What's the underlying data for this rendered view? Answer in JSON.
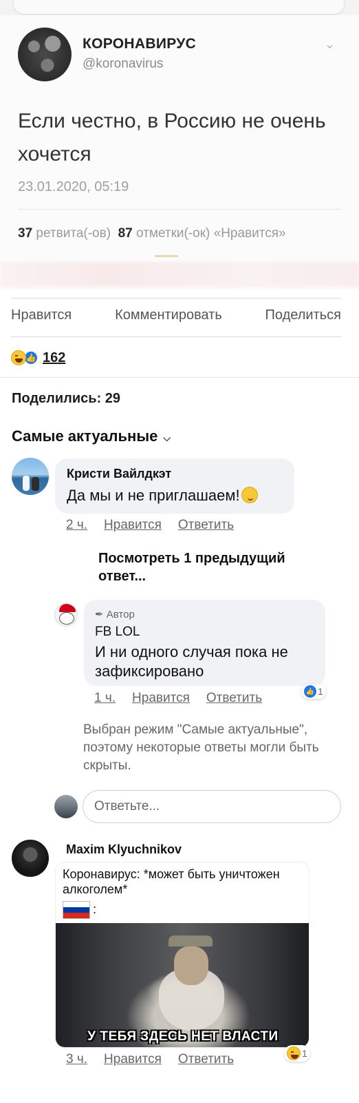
{
  "tweet": {
    "name": "КОРОНАВИРУС",
    "handle": "@koronavirus",
    "text": "Если честно, в Россию не очень хочется",
    "date": "23.01.2020, 05:19",
    "retweets_count": "37",
    "retweets_label": "ретвита(-ов)",
    "likes_count": "87",
    "likes_label": "отметки(-ок) «Нравится»"
  },
  "actions": {
    "like": "Нравится",
    "comment": "Комментировать",
    "share": "Поделиться"
  },
  "reactions": {
    "count": "162"
  },
  "shares_text": "Поделились: 29",
  "sort_label": "Самые актуальные",
  "comments": [
    {
      "author": "Кристи Вайлдкэт",
      "text": "Да мы и не приглашаем!",
      "time": "2 ч.",
      "like": "Нравится",
      "reply": "Ответить"
    },
    {
      "author": "FB LOL",
      "badge": "Автор",
      "text": "И ни одного случая пока не зафиксировано",
      "time": "1 ч.",
      "like": "Нравится",
      "reply": "Ответить",
      "reaction_count": "1"
    },
    {
      "author": "Maxim Klyuchnikov",
      "meme_caption": "Коронавирус: *может быть уничтожен алкоголем*",
      "meme_colon": ":",
      "meme_subtitle": "У ТЕБЯ ЗДЕСЬ НЕТ ВЛАСТИ",
      "time": "3 ч.",
      "like": "Нравится",
      "reply": "Ответить",
      "reaction_count": "1"
    }
  ],
  "prev_replies": "Посмотреть 1 предыдущий ответ...",
  "mode_note": "Выбран режим \"Самые актуальные\", поэтому некоторые ответы могли быть скрыты.",
  "reply_placeholder": "Ответьте...",
  "colors": {
    "accent_blue": "#1877f2",
    "secondary_text": "#65676b",
    "bubble": "#f0f2f5"
  },
  "icons": [
    "chevron-down-icon",
    "laugh-reaction-icon",
    "like-reaction-icon",
    "wink-emoji-icon",
    "pencil-icon",
    "russia-flag-icon"
  ]
}
